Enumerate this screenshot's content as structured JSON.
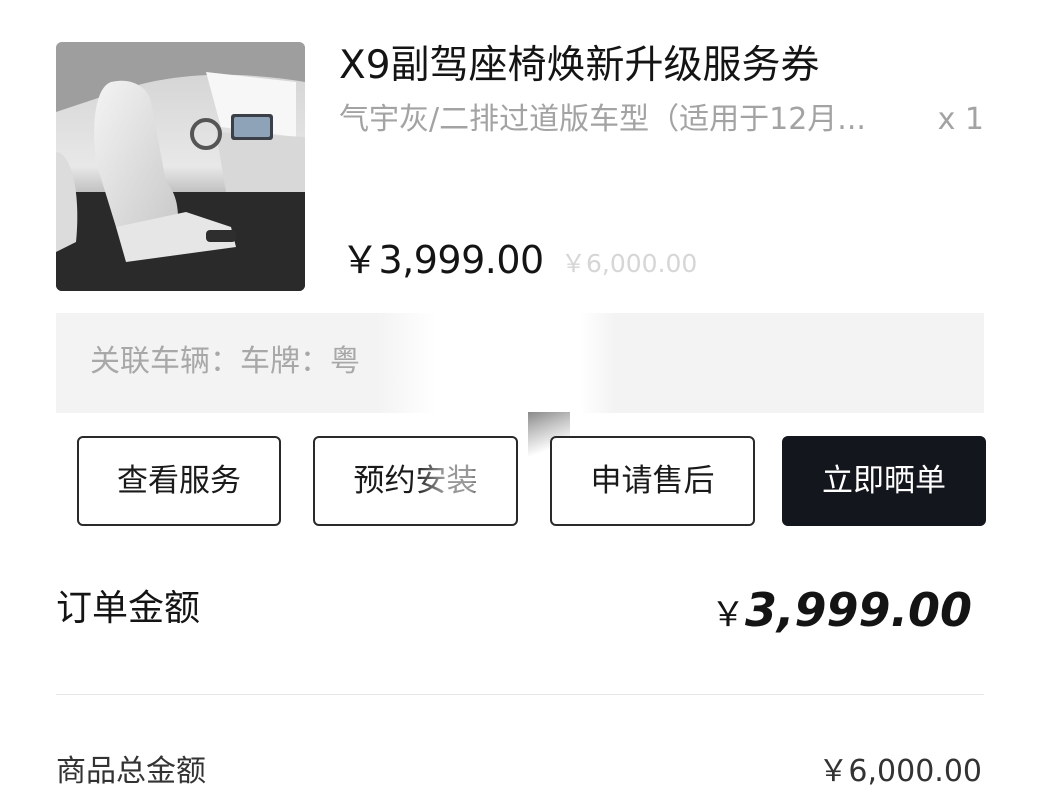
{
  "product": {
    "title": "X9副驾座椅焕新升级服务券",
    "spec": "气宇灰/二排过道版车型（适用于12月...",
    "quantity": "x 1",
    "price_current": "￥3,999.00",
    "price_original": "￥6,000.00",
    "image_icon": "car-seat-image"
  },
  "vehicle": {
    "text": "关联车辆：车牌：粤"
  },
  "actions": {
    "view_service": "查看服务",
    "book_install": "预约安装",
    "after_sales": "申请售后",
    "share_order": "立即晒单"
  },
  "order": {
    "label": "订单金额",
    "currency": "￥",
    "amount": "3,999.00"
  },
  "summary": {
    "total_label": "商品总金额",
    "total_value": "￥6,000.00"
  },
  "colors": {
    "primary_button": "#14161d",
    "muted_text": "#a3a3a3",
    "panel_bg": "#f3f3f3"
  }
}
